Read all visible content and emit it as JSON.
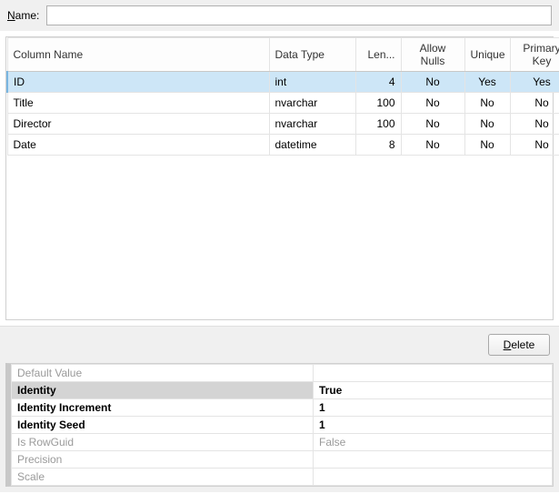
{
  "top": {
    "name_label": "Name:",
    "name_value": ""
  },
  "columns": {
    "headers": [
      "Column Name",
      "Data Type",
      "Len...",
      "Allow Nulls",
      "Unique",
      "Primary Key"
    ],
    "rows": [
      {
        "name": "ID",
        "type": "int",
        "len": "4",
        "nulls": "No",
        "unique": "Yes",
        "pk": "Yes",
        "selected": true
      },
      {
        "name": "Title",
        "type": "nvarchar",
        "len": "100",
        "nulls": "No",
        "unique": "No",
        "pk": "No",
        "selected": false
      },
      {
        "name": "Director",
        "type": "nvarchar",
        "len": "100",
        "nulls": "No",
        "unique": "No",
        "pk": "No",
        "selected": false
      },
      {
        "name": "Date",
        "type": "datetime",
        "len": "8",
        "nulls": "No",
        "unique": "No",
        "pk": "No",
        "selected": false
      }
    ]
  },
  "buttons": {
    "delete": "Delete"
  },
  "properties": [
    {
      "label": "Default Value",
      "value": "",
      "disabled": true,
      "active": false,
      "bold": false
    },
    {
      "label": "Identity",
      "value": "True",
      "disabled": false,
      "active": true,
      "bold": true
    },
    {
      "label": "Identity Increment",
      "value": "1",
      "disabled": false,
      "active": false,
      "bold": true
    },
    {
      "label": "Identity Seed",
      "value": "1",
      "disabled": false,
      "active": false,
      "bold": true
    },
    {
      "label": "Is RowGuid",
      "value": "False",
      "disabled": true,
      "active": false,
      "bold": false
    },
    {
      "label": "Precision",
      "value": "",
      "disabled": true,
      "active": false,
      "bold": false
    },
    {
      "label": "Scale",
      "value": "",
      "disabled": true,
      "active": false,
      "bold": false
    }
  ]
}
